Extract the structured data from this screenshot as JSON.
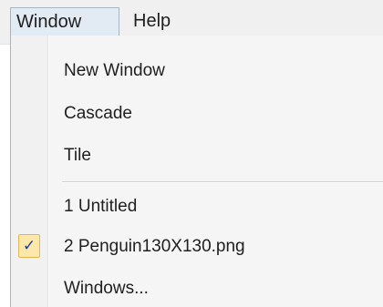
{
  "menubar": {
    "items": [
      {
        "label": "Window"
      },
      {
        "label": "Help"
      }
    ]
  },
  "window_menu": {
    "items": [
      {
        "label": "New Window"
      },
      {
        "label": "Cascade"
      },
      {
        "label": "Tile"
      },
      {
        "label": "1 Untitled"
      },
      {
        "label": "2 Penguin130X130.png",
        "checked": true
      },
      {
        "label": "Windows..."
      }
    ],
    "check_glyph": "✓",
    "check_icon": "checkmark-icon"
  },
  "colors": {
    "menubar_bg": "#f0f0f0",
    "active_menu_bg": "#e2eaf3",
    "check_bg": "#fde7a9",
    "check_border": "#e7b64e",
    "check_mark": "#1f3f8f"
  }
}
